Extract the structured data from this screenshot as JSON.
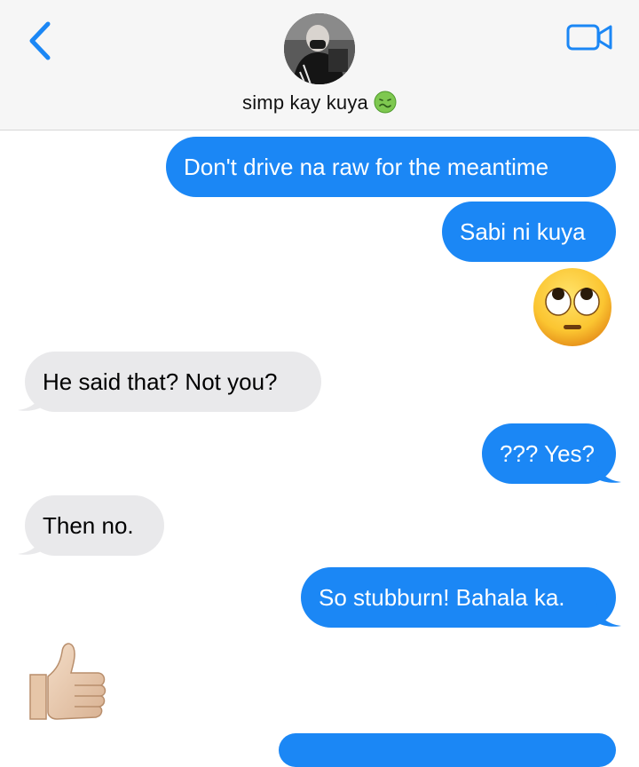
{
  "header": {
    "contact_name": "simp kay kuya",
    "contact_emoji": "nauseated-face-icon",
    "back_icon": "chevron-left-icon",
    "video_icon": "video-camera-icon"
  },
  "colors": {
    "outgoing_bubble": "#1b87f5",
    "incoming_bubble": "#e9e9eb",
    "accent": "#1b87f5",
    "header_bg": "#f6f6f6"
  },
  "messages": [
    {
      "direction": "outgoing",
      "text": "Don't drive na raw for the meantime"
    },
    {
      "direction": "outgoing",
      "text": "Sabi ni kuya"
    },
    {
      "direction": "outgoing",
      "emoji": "face-with-rolling-eyes-icon"
    },
    {
      "direction": "incoming",
      "text": "He said that? Not you?"
    },
    {
      "direction": "outgoing",
      "text": "??? Yes?"
    },
    {
      "direction": "incoming",
      "text": "Then no."
    },
    {
      "direction": "outgoing",
      "text": "So stubburn! Bahala ka."
    },
    {
      "direction": "incoming",
      "emoji": "thumbs-up-icon"
    }
  ]
}
